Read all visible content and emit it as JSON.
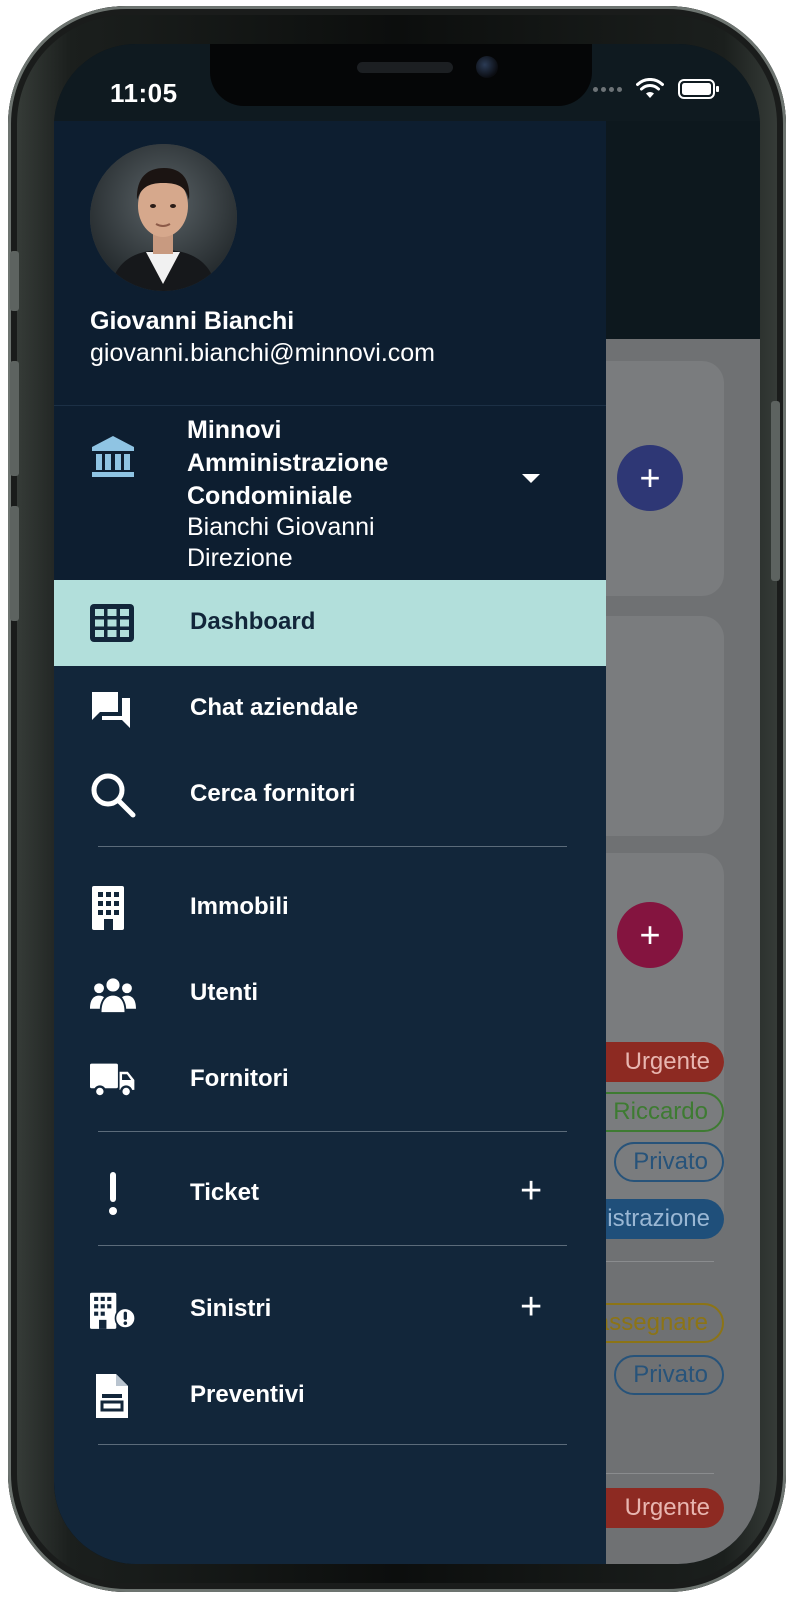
{
  "status_bar": {
    "time": "11:05"
  },
  "profile": {
    "name": "Giovanni Bianchi",
    "email": "giovanni.bianchi@minnovi.com"
  },
  "company": {
    "name_line1": "Minnovi",
    "name_line2": "Amministrazione",
    "name_line3": "Condominiale",
    "person": "Bianchi Giovanni",
    "role": "Direzione"
  },
  "menu": {
    "dashboard": "Dashboard",
    "chat": "Chat aziendale",
    "search_suppliers": "Cerca fornitori",
    "properties": "Immobili",
    "users": "Utenti",
    "suppliers": "Fornitori",
    "tickets": "Ticket",
    "claims": "Sinistri",
    "quotes": "Preventivi",
    "add_symbol": "+"
  },
  "background": {
    "fab_symbol": "+",
    "chips": [
      "Urgente",
      "Riccardo",
      "Privato",
      "Amministrazione",
      "Da assegnare",
      "Privato",
      "Urgente"
    ]
  },
  "icons": {
    "company": "bank-icon",
    "dashboard": "grid-icon",
    "chat": "forum-icon",
    "search": "search-icon",
    "properties": "building-icon",
    "users": "users-icon",
    "suppliers": "truck-icon",
    "tickets": "exclamation-icon",
    "claims": "building-alert-icon",
    "quotes": "document-icon"
  },
  "colors": {
    "drawer": "#12263a",
    "drawer_header": "#0d1e30",
    "active_item": "#b2dfdb"
  }
}
